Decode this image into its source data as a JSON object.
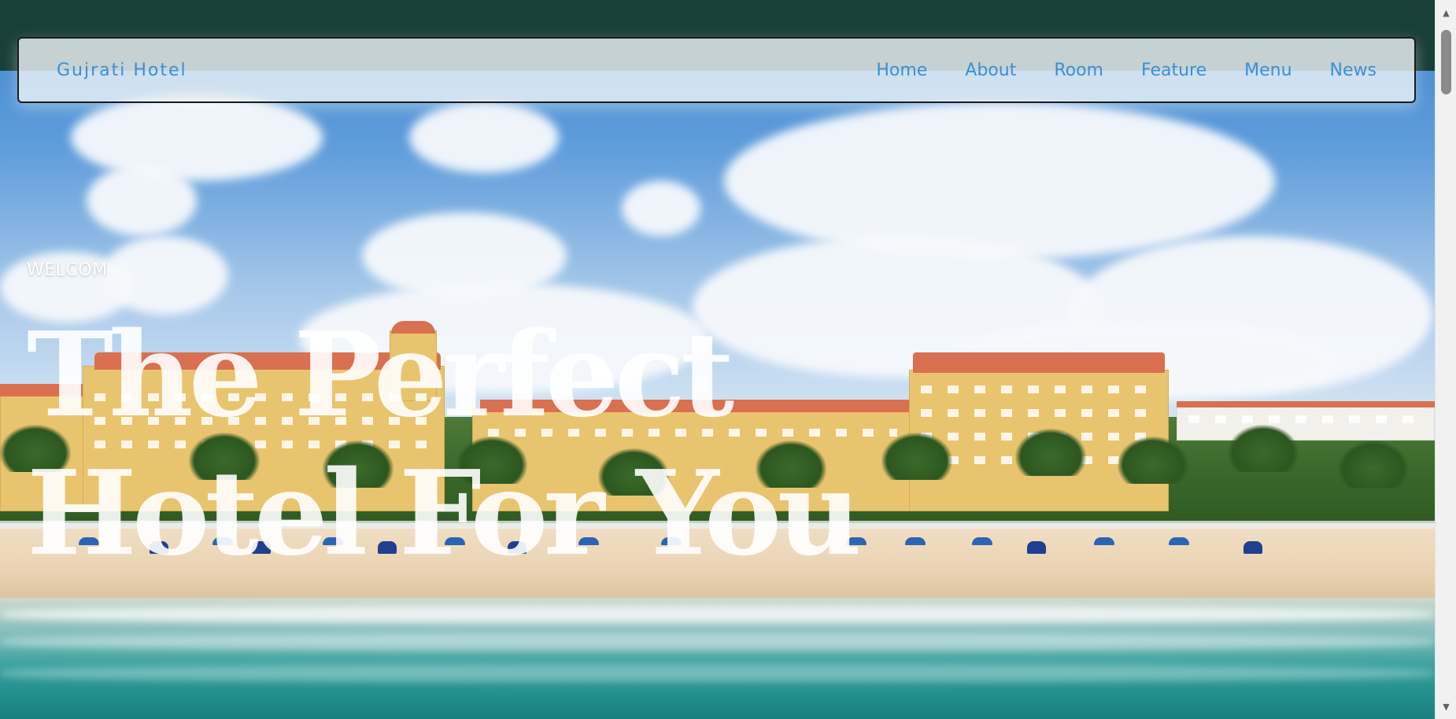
{
  "nav": {
    "brand": "Gujrati Hotel",
    "links": [
      {
        "label": "Home"
      },
      {
        "label": "About"
      },
      {
        "label": "Room"
      },
      {
        "label": "Feature"
      },
      {
        "label": "Menu"
      },
      {
        "label": "News"
      }
    ]
  },
  "hero": {
    "eyebrow": "WELCOM",
    "headline_line1": "The Perfect",
    "headline_line2": "Hotel For You"
  },
  "scrollbar": {
    "up_icon": "chevron-up-icon",
    "down_icon": "chevron-down-icon"
  },
  "colors": {
    "nav_text": "#3a8fd6",
    "top_band": "#173d33",
    "headline": "#ffffff"
  }
}
